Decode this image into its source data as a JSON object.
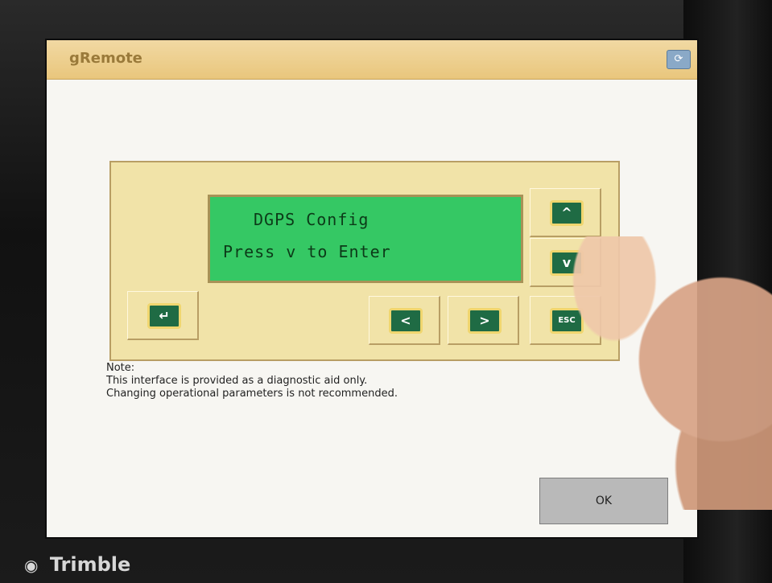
{
  "device": {
    "brand": "Trimble",
    "logo_icon": "trimble-globe-icon"
  },
  "window": {
    "title": "gRemote",
    "minimize_icon": "window-minimize-icon"
  },
  "lcd": {
    "line1": "DGPS Config",
    "line2": "Press v to Enter"
  },
  "keys": {
    "up": "^",
    "down": "v",
    "left": "<",
    "right": ">",
    "enter": "↵",
    "esc": "ESC"
  },
  "note": {
    "label": "Note:",
    "line1": "This interface is provided as a diagnostic aid only.",
    "line2": "Changing operational parameters is not recommended."
  },
  "buttons": {
    "ok": "OK"
  },
  "colors": {
    "panel": "#f1e3a8",
    "lcd": "#35c864",
    "key": "#1f6b44"
  }
}
